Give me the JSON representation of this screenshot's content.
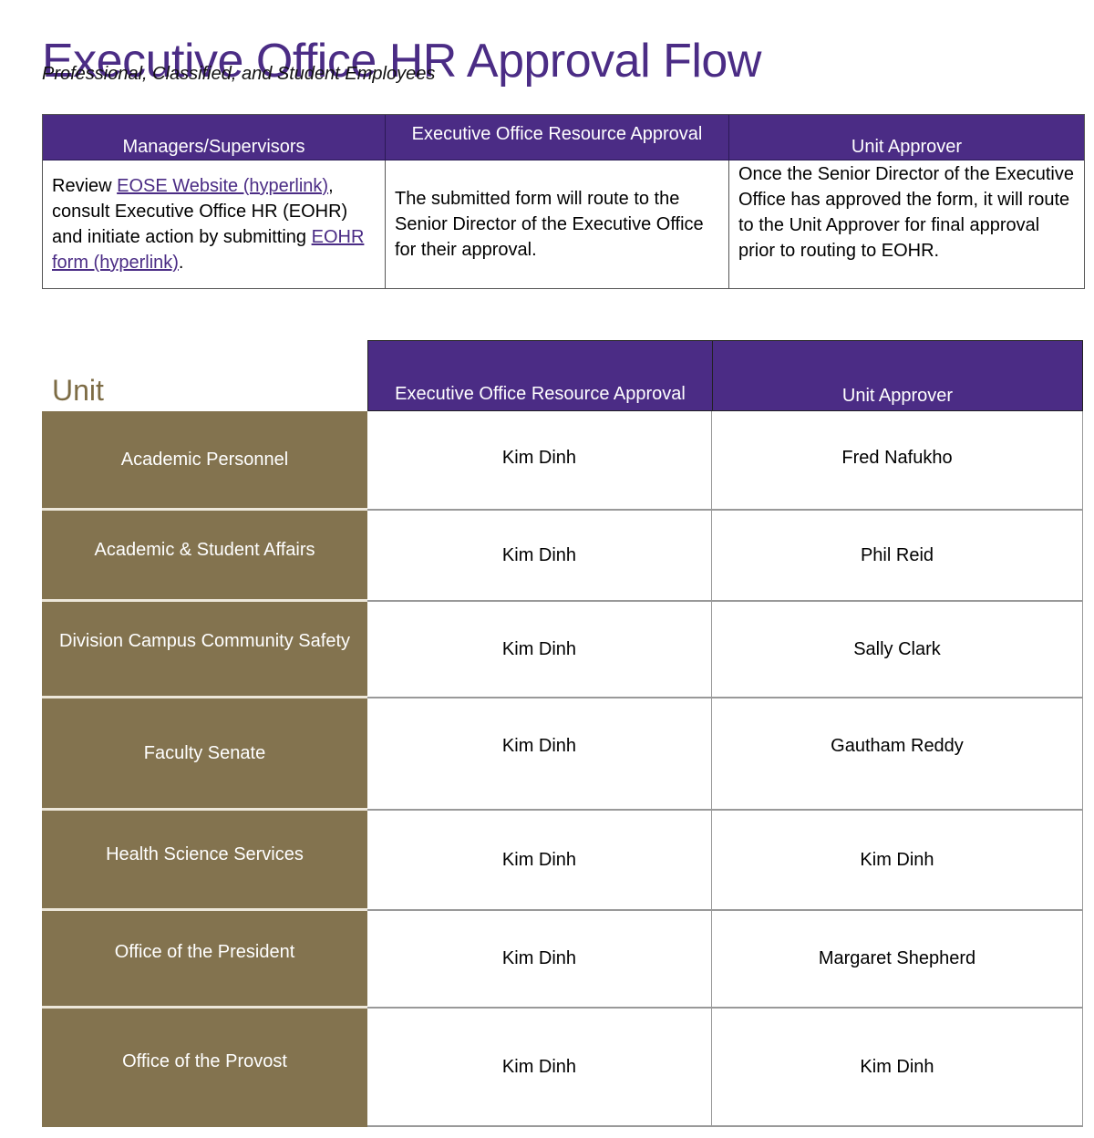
{
  "header": {
    "title": "Executive Office HR Approval Flow",
    "subtitle": "Professional, Classified, and Student Employees"
  },
  "flow_table": {
    "columns": [
      {
        "header": "Managers/Supervisors",
        "text_review": "Review ",
        "link_eose": "EOSE Website (hyperlink)",
        "text_mid": ", consult Executive Office HR (EOHR) and initiate action by submitting ",
        "link_form": "EOHR form (hyperlink)",
        "text_end": "."
      },
      {
        "header": "Executive Office Resource Approval",
        "text": "The submitted form will route to the Senior Director of the Executive Office for their approval."
      },
      {
        "header": "Unit Approver",
        "text": "Once the Senior Director of the Executive Office has approved the form, it will route to the Unit Approver for final approval prior to routing to EOHR."
      }
    ]
  },
  "approver_table": {
    "unit_label": "Unit",
    "headers": [
      "Executive Office Resource Approval",
      "Unit Approver"
    ],
    "rows": [
      {
        "unit": "Academic Personnel",
        "resource_approval": "Kim Dinh",
        "unit_approver": "Fred Nafukho"
      },
      {
        "unit": "Academic & Student Affairs",
        "resource_approval": "Kim Dinh",
        "unit_approver": "Phil Reid"
      },
      {
        "unit": "Division Campus Community Safety",
        "resource_approval": "Kim Dinh",
        "unit_approver": "Sally Clark"
      },
      {
        "unit": "Faculty Senate",
        "resource_approval": "Kim Dinh",
        "unit_approver": "Gautham Reddy"
      },
      {
        "unit": "Health Science Services",
        "resource_approval": "Kim Dinh",
        "unit_approver": "Kim Dinh"
      },
      {
        "unit": "Office of the President",
        "resource_approval": "Kim Dinh",
        "unit_approver": "Margaret Shepherd"
      },
      {
        "unit": "Office of the Provost",
        "resource_approval": "Kim Dinh",
        "unit_approver": "Kim Dinh"
      }
    ]
  },
  "colors": {
    "brand_purple": "#4b2c85",
    "unit_gold": "#83734f"
  }
}
